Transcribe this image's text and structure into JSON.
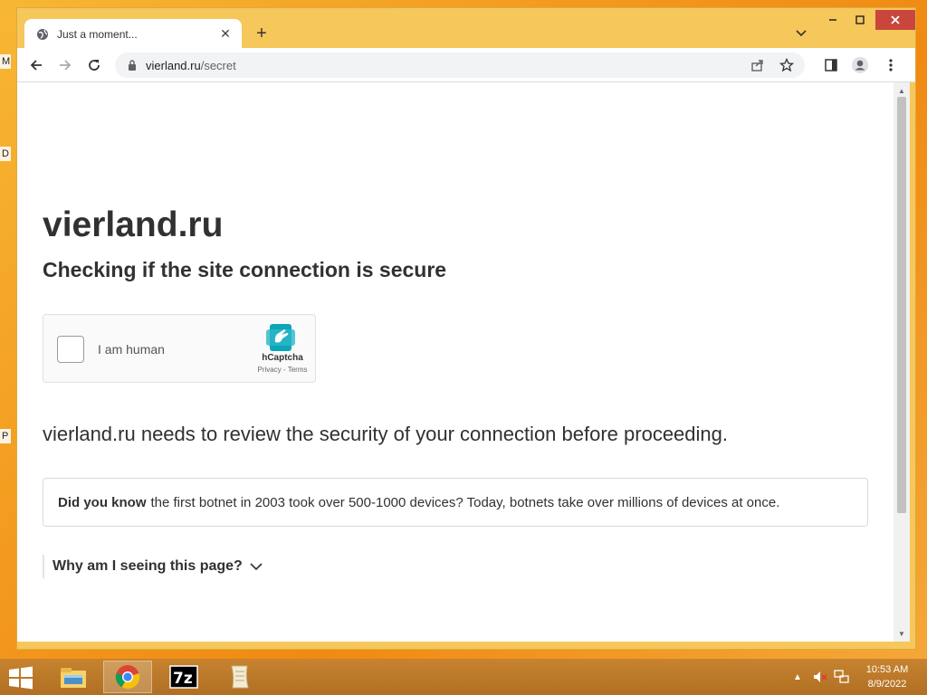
{
  "desktop": {
    "frag1": "M",
    "frag2": "D",
    "frag3": "P"
  },
  "browser": {
    "tab": {
      "title": "Just a moment...",
      "favicon": "globe-icon",
      "close": "✕"
    },
    "new_tab": "+",
    "url_host": "vierland.ru",
    "url_path": "/secret"
  },
  "page": {
    "site_title": "vierland.ru",
    "subtitle": "Checking if the site connection is secure",
    "captcha": {
      "label": "I am human",
      "brand": "hCaptcha",
      "links": "Privacy - Terms"
    },
    "review_text": "vierland.ru needs to review the security of your connection before proceeding.",
    "did_you_know_label": "Did you know",
    "did_you_know_text": "the first botnet in 2003 took over 500-1000 devices? Today, botnets take over millions of devices at once.",
    "why_label": "Why am I seeing this page?"
  },
  "taskbar": {
    "time": "10:53 AM",
    "date": "8/9/2022",
    "apps": [
      "file-explorer",
      "chrome",
      "7zip",
      "notepad"
    ]
  },
  "colors": {
    "desktop_orange": "#f39a1e",
    "chrome_frame": "#f6c75a",
    "close_red": "#c9463d",
    "hcaptcha_teal": "#0074bf"
  }
}
